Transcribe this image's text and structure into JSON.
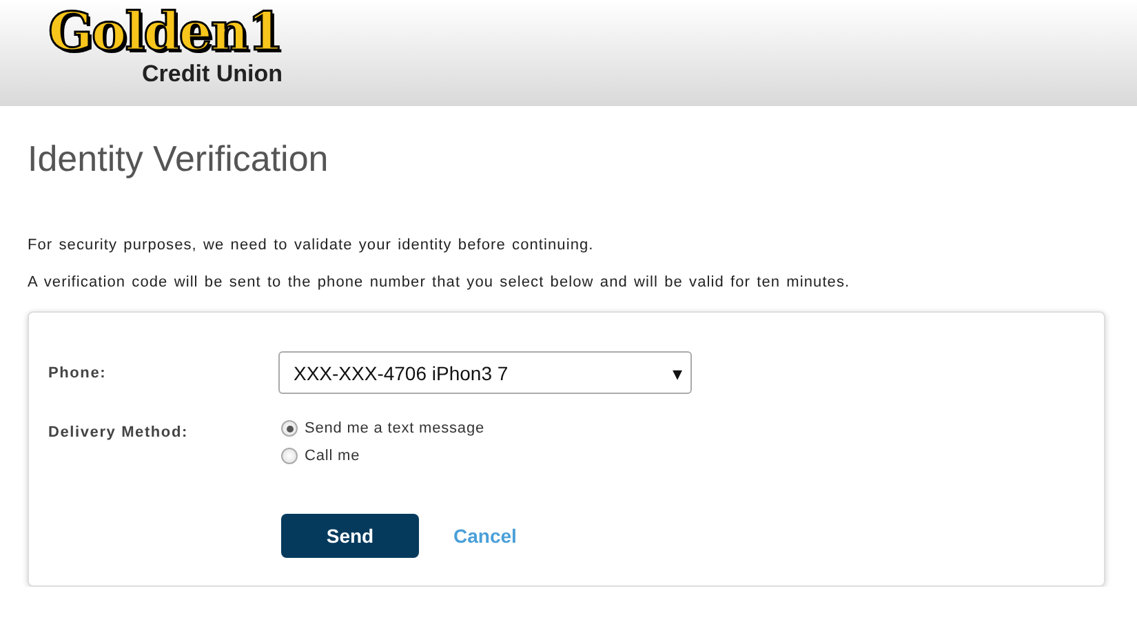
{
  "header": {
    "logo": {
      "wordmark": "Golden1",
      "tagline": "Credit Union"
    }
  },
  "title": "Identity Verification",
  "intro": [
    "For security purposes, we need to validate your identity before continuing.",
    "A verification code will be sent to the phone number that you select below and will be valid for ten minutes."
  ],
  "form": {
    "phone": {
      "label": "Phone:",
      "value": "XXX-XXX-4706 iPhon3 7",
      "caret": "▾"
    },
    "delivery": {
      "label": "Delivery Method:",
      "options": [
        {
          "label": "Send me a text message",
          "selected": true
        },
        {
          "label": "Call me",
          "selected": false
        }
      ]
    },
    "buttons": [
      {
        "kind": "primary",
        "label": "Send"
      },
      {
        "kind": "link",
        "label": "Cancel"
      }
    ]
  }
}
